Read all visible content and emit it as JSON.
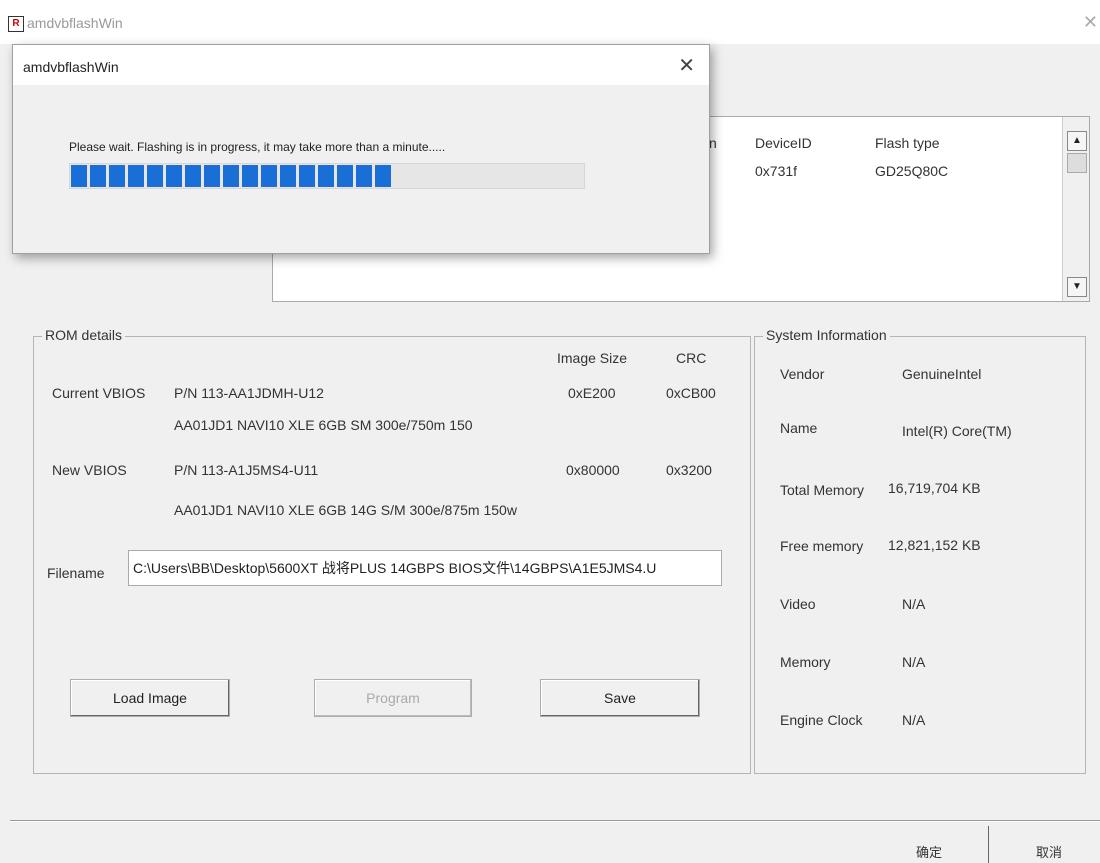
{
  "main_window": {
    "title": "amdvbflashWin",
    "app_icon_letter": "R"
  },
  "device_list": {
    "partial_col": "n",
    "columns": [
      "DeviceID",
      "Flash type"
    ],
    "row": [
      "0x731f",
      "GD25Q80C"
    ]
  },
  "rom_details": {
    "legend": "ROM details",
    "image_size_header": "Image Size",
    "crc_header": "CRC",
    "current": {
      "label": "Current VBIOS",
      "pn": "P/N  113-AA1JDMH-U12",
      "desc": "AA01JD1 NAVI10 XLE 6GB SM 300e/750m 150",
      "size": "0xE200",
      "crc": "0xCB00"
    },
    "new": {
      "label": "New VBIOS",
      "pn": "P/N  113-A1J5MS4-U11",
      "desc": "AA01JD1 NAVI10 XLE 6GB 14G S/M 300e/875m 150w",
      "size": "0x80000",
      "crc": "0x3200"
    },
    "filename_label": "Filename",
    "filename_value": "C:\\Users\\BB\\Desktop\\5600XT 战将PLUS 14GBPS BIOS文件\\14GBPS\\A1E5JMS4.U",
    "buttons": {
      "load": "Load Image",
      "program": "Program",
      "save": "Save"
    }
  },
  "system_info": {
    "legend": "System Information",
    "rows": [
      {
        "label": "Vendor",
        "value": "GenuineIntel"
      },
      {
        "label": "Name",
        "value": "Intel(R) Core(TM)"
      },
      {
        "label": "Total Memory",
        "value": "16,719,704 KB"
      },
      {
        "label": "Free memory",
        "value": "12,821,152 KB"
      },
      {
        "label": "Video",
        "value": "N/A"
      },
      {
        "label": "Memory",
        "value": "N/A"
      },
      {
        "label": "Engine Clock",
        "value": "N/A"
      }
    ]
  },
  "footer": {
    "ok": "确定",
    "cancel": "取消"
  },
  "progress_dialog": {
    "title": "amdvbflashWin",
    "message": "Please wait.  Flashing is in progress, it may take more than a minute.....",
    "progress": 0.63
  },
  "colors": {
    "progress": "#1a6fd6",
    "window_bg": "#f0f0f0"
  }
}
